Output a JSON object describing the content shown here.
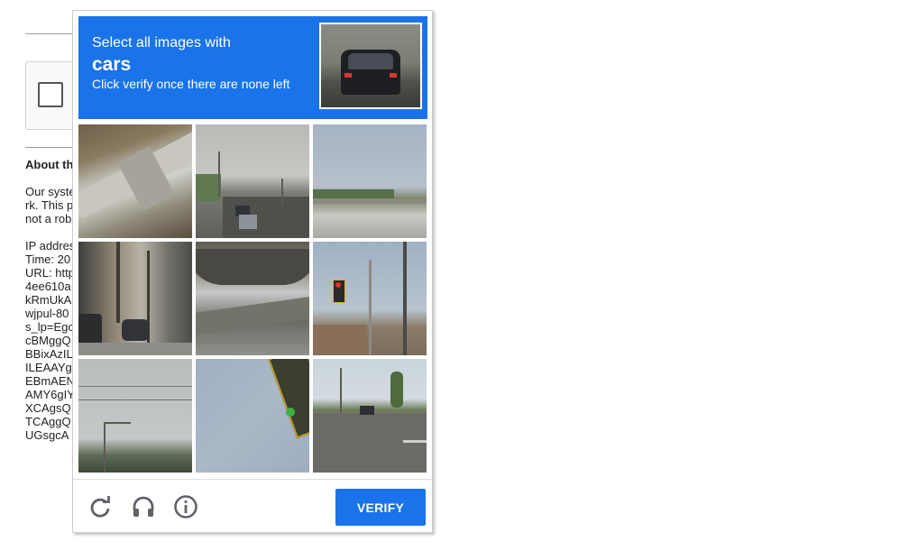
{
  "background_page": {
    "heading": "About th",
    "paragraph_lines": [
      "Our syste",
      "rk. This p",
      "not a rob"
    ],
    "info_lines": [
      "IP addres",
      "Time: 20",
      "URL: http",
      "4ee610a",
      "kRmUkA",
      "wjpul-80",
      "s_lp=Egc",
      "cBMggQ",
      "BBixAzIL",
      "ILEAAYg",
      "EBmAEN",
      "AMY6gIY",
      "XCAgsQ",
      "TCAggQ",
      "UGsgcA"
    ]
  },
  "challenge": {
    "instruction_line1": "Select all images with",
    "target_object": "cars",
    "instruction_line2": "Click verify once there are none left",
    "example_image": "car-rear-example",
    "tiles": [
      {
        "scene": "stone-wall-closeup"
      },
      {
        "scene": "street-with-cars"
      },
      {
        "scene": "highway-overpass"
      },
      {
        "scene": "sidewalk-scooters-cars"
      },
      {
        "scene": "underpass-bridge"
      },
      {
        "scene": "traffic-light-pole"
      },
      {
        "scene": "power-lines-street-light"
      },
      {
        "scene": "traffic-light-closeup"
      },
      {
        "scene": "street-with-palm-trees-car"
      }
    ]
  },
  "footer": {
    "reload_icon": "reload-icon",
    "audio_icon": "headphones-icon",
    "info_icon": "info-icon",
    "verify_label": "VERIFY"
  },
  "colors": {
    "accent": "#1a73e8",
    "icon_gray": "#5f6368"
  }
}
